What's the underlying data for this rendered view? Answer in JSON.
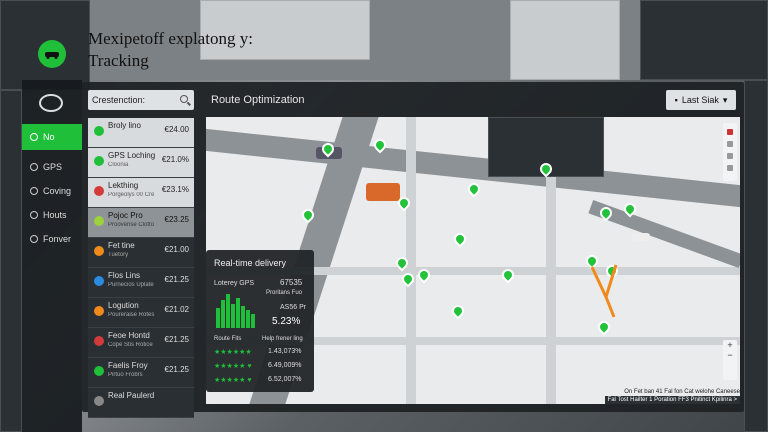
{
  "app": {
    "title_line1": "Mexipetoff explatong y:",
    "title_line2": "Tracking"
  },
  "rail": {
    "items": [
      {
        "label": "No",
        "icon": "dashboard-icon",
        "active": true
      },
      {
        "label": "GPS",
        "icon": "gps-icon"
      },
      {
        "label": "Coving",
        "icon": "coving-icon"
      },
      {
        "label": "Houts",
        "icon": "hours-icon"
      },
      {
        "label": "Fonver",
        "icon": "folder-icon"
      }
    ]
  },
  "search": {
    "value": "Crestenction:",
    "placeholder": "Crestenction:"
  },
  "main": {
    "title": "Route Optimization",
    "last_button": "Last Siak"
  },
  "vehicles": [
    {
      "name": "Broly lino",
      "sub": "",
      "value": "€24.00",
      "color": "#1fbf3a",
      "style": "light"
    },
    {
      "name": "GPS Loching",
      "sub": "Cloonia",
      "value": "€21.0%",
      "color": "#1fbf3a",
      "style": "light"
    },
    {
      "name": "Lekthing",
      "sub": "Porgeolys 00 Cre",
      "value": "€23.1%",
      "color": "#d33a3a",
      "style": "light"
    },
    {
      "name": "Pojoc Pro",
      "sub": "Proovense Clotto",
      "value": "€23.25",
      "color": "#9bd23a",
      "style": "sel"
    },
    {
      "name": "Fet tine",
      "sub": "Tuetory",
      "value": "€21.00",
      "color": "#f08a1c",
      "style": "dark"
    },
    {
      "name": "Flos Lins",
      "sub": "Purnecios Uplate",
      "value": "€21.25",
      "color": "#2a8be0",
      "style": "dark"
    },
    {
      "name": "Logution",
      "sub": "Poureraise Rotes",
      "value": "€21.02",
      "color": "#f08a1c",
      "style": "dark"
    },
    {
      "name": "Feoe Hontd",
      "sub": "Cope Stis Rotice",
      "value": "€21.25",
      "color": "#d33a3a",
      "style": "dark"
    },
    {
      "name": "Faelis Froy",
      "sub": "Pirtuo Frobrs",
      "value": "€21.25",
      "color": "#1fbf3a",
      "style": "dark"
    },
    {
      "name": "Real Paulerd",
      "sub": "",
      "value": "",
      "color": "#888888",
      "style": "dark"
    }
  ],
  "delivery": {
    "title": "Real-time delivery",
    "gps_label": "Loterey GPS",
    "gps_value": "67535",
    "sub_label": "Proritans Fuo",
    "rate_label": "AS56 Pr",
    "rate_value": "5.23%",
    "route_label": "Route Fits",
    "help_label": "Help frener ling",
    "rows": [
      {
        "stars": "★★★★★★",
        "value": "1.43,073%"
      },
      {
        "stars": "★★★★★ ♥",
        "value": "6.49,009%"
      },
      {
        "stars": "★★★★★ ♥",
        "value": "6.52,007%"
      }
    ]
  },
  "status": {
    "line1": "On Fet ban 41 Fal fon Cat welohe Caneese",
    "line2": "Fal Tost Hailter 1 Poration FF3 Pnitinct Kpilinra >"
  },
  "colors": {
    "accent": "#1fbf3a",
    "route": "#f08a1c"
  }
}
